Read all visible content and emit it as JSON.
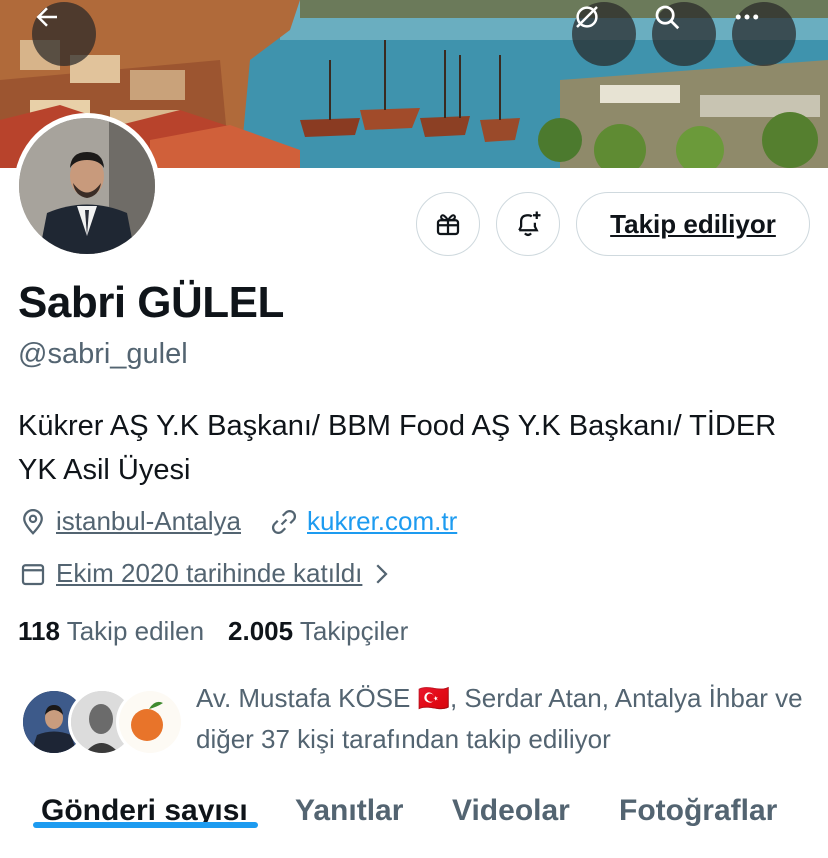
{
  "header": {
    "back_icon": "arrow-left-icon",
    "translate_icon": "circle-slash-icon",
    "search_icon": "search-icon",
    "more_icon": "more-horizontal-icon"
  },
  "profile": {
    "name": "Sabri GÜLEL",
    "handle": "@sabri_gulel",
    "bio": "Kükrer AŞ Y.K Başkanı/ BBM Food AŞ Y.K Başkanı/ TİDER YK Asil Üyesi",
    "location": "istanbul-Antalya",
    "website": "kukrer.com.tr",
    "joined": "Ekim 2020 tarihinde katıldı",
    "following_count": "118",
    "following_label": "Takip edilen",
    "followers_count": "2.005",
    "followers_label": "Takipçiler"
  },
  "actions": {
    "follow_label": "Takip ediliyor",
    "gift_icon": "gift-icon",
    "notify_icon": "bell-plus-icon"
  },
  "followed_by": {
    "text_part1": "Av. Mustafa KÖSE ",
    "flag": "🇹🇷",
    "text_part2": ", Serdar Atan, Antalya İhbar ve diğer 37 kişi tarafından takip ediliyor"
  },
  "tabs": [
    {
      "label": "Gönderi sayısı",
      "active": true
    },
    {
      "label": "Yanıtlar"
    },
    {
      "label": "Videolar"
    },
    {
      "label": "Fotoğraflar"
    }
  ],
  "colors": {
    "accent": "#1d9bf0",
    "secondary_text": "#536471",
    "primary_text": "#0f1419"
  }
}
